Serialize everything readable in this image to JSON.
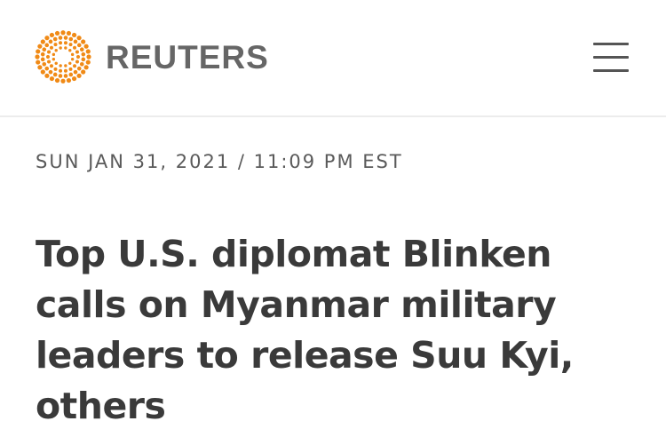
{
  "header": {
    "logo_text": "REUTERS",
    "logo_color": "#f08a16",
    "logo_icon": "reuters-dot-ring-icon",
    "menu_icon": "hamburger-menu-icon"
  },
  "article": {
    "dateline": "SUN JAN 31, 2021 / 11:09 PM EST",
    "headline": "Top U.S. diplomat Blinken calls on Myanmar military leaders to release Suu Kyi, others"
  }
}
